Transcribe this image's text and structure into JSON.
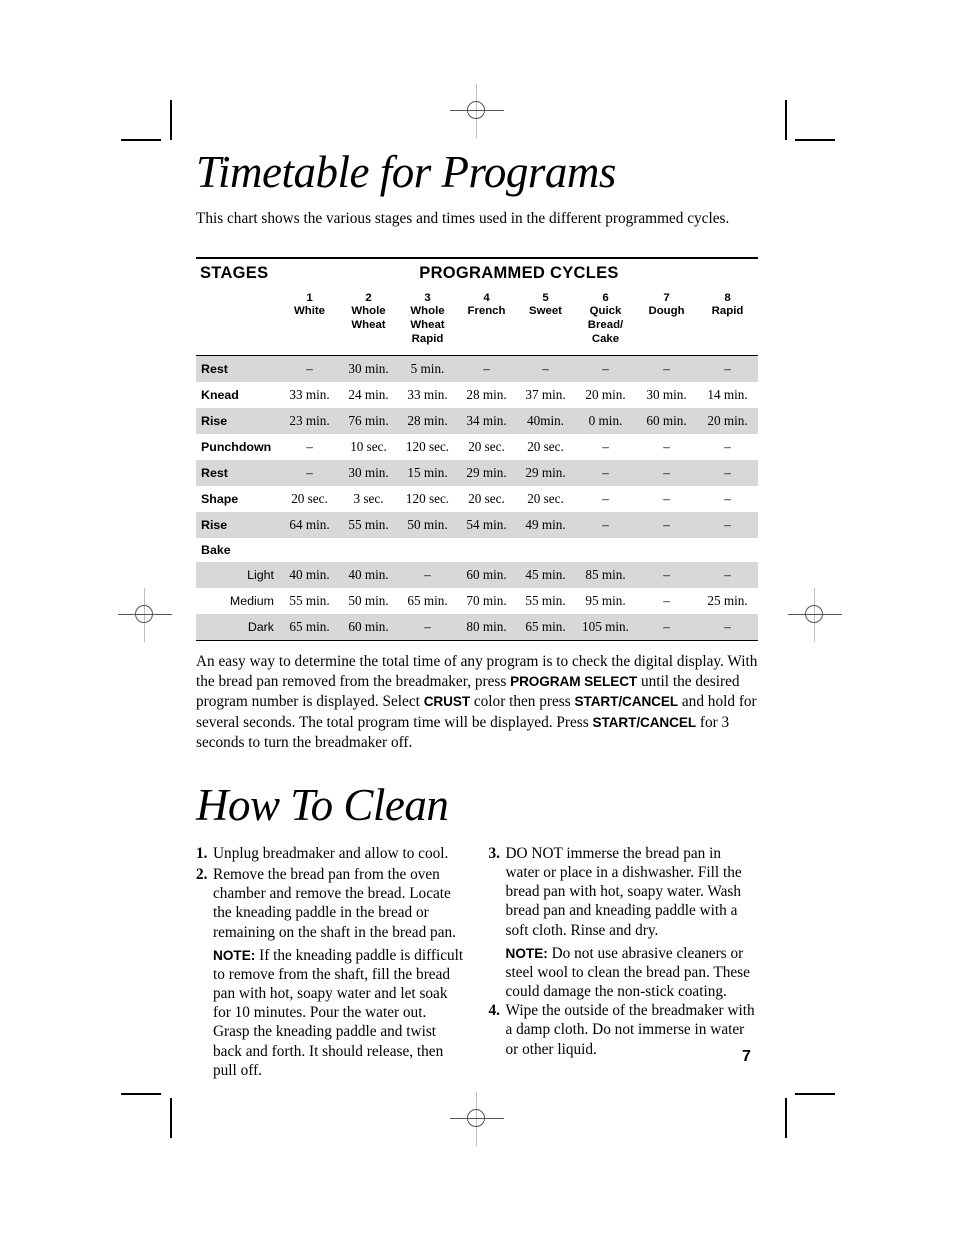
{
  "document": {
    "page_number": "7"
  },
  "section1": {
    "title": "Timetable for Programs",
    "intro": "This chart shows the various stages and times used in the different programmed cycles."
  },
  "table": {
    "stages_header": "STAGES",
    "cycles_header": "PROGRAMMED CYCLES",
    "columns": [
      {
        "num": "1",
        "name": "White"
      },
      {
        "num": "2",
        "name": "Whole\nWheat"
      },
      {
        "num": "3",
        "name": "Whole\nWheat\nRapid"
      },
      {
        "num": "4",
        "name": "French"
      },
      {
        "num": "5",
        "name": "Sweet"
      },
      {
        "num": "6",
        "name": "Quick\nBread/\nCake"
      },
      {
        "num": "7",
        "name": "Dough"
      },
      {
        "num": "8",
        "name": "Rapid"
      }
    ],
    "rows": [
      {
        "stage": "Rest",
        "shaded": true,
        "sub": false,
        "values": [
          "–",
          "30 min.",
          "5 min.",
          "–",
          "–",
          "–",
          "–",
          "–"
        ]
      },
      {
        "stage": "Knead",
        "shaded": false,
        "sub": false,
        "values": [
          "33 min.",
          "24 min.",
          "33 min.",
          "28 min.",
          "37 min.",
          "20 min.",
          "30 min.",
          "14 min."
        ]
      },
      {
        "stage": "Rise",
        "shaded": true,
        "sub": false,
        "values": [
          "23 min.",
          "76 min.",
          "28 min.",
          "34 min.",
          "40min.",
          "0 min.",
          "60 min.",
          "20 min."
        ]
      },
      {
        "stage": "Punchdown",
        "shaded": false,
        "sub": false,
        "values": [
          "–",
          "10 sec.",
          "120 sec.",
          "20 sec.",
          "20 sec.",
          "–",
          "–",
          "–"
        ]
      },
      {
        "stage": "Rest",
        "shaded": true,
        "sub": false,
        "values": [
          "–",
          "30 min.",
          "15 min.",
          "29 min.",
          "29 min.",
          "–",
          "–",
          "–"
        ]
      },
      {
        "stage": "Shape",
        "shaded": false,
        "sub": false,
        "values": [
          "20 sec.",
          "3 sec.",
          "120 sec.",
          "20 sec.",
          "20 sec.",
          "–",
          "–",
          "–"
        ]
      },
      {
        "stage": "Rise",
        "shaded": true,
        "sub": false,
        "values": [
          "64 min.",
          "55 min.",
          "50 min.",
          "54 min.",
          "49 min.",
          "–",
          "–",
          "–"
        ]
      },
      {
        "stage": "Bake",
        "shaded": false,
        "sub": false,
        "values": [
          "",
          "",
          "",
          "",
          "",
          "",
          "",
          ""
        ]
      },
      {
        "stage": "Light",
        "shaded": true,
        "sub": true,
        "values": [
          "40 min.",
          "40 min.",
          "–",
          "60 min.",
          "45 min.",
          "85 min.",
          "–",
          "–"
        ]
      },
      {
        "stage": "Medium",
        "shaded": false,
        "sub": true,
        "values": [
          "55 min.",
          "50 min.",
          "65 min.",
          "70 min.",
          "55 min.",
          "95 min.",
          "–",
          "25 min."
        ]
      },
      {
        "stage": "Dark",
        "shaded": true,
        "sub": true,
        "values": [
          "65 min.",
          "60 min.",
          "–",
          "80 min.",
          "65 min.",
          "105 min.",
          "–",
          "–"
        ]
      }
    ]
  },
  "after_table": {
    "p1": "An easy way to determine the total time of any program is to check the digital display. With the bread pan removed from the breadmaker, press ",
    "cmd1": "PROGRAM SELECT",
    "p2": " until the desired program number is displayed. Select ",
    "cmd2": "CRUST",
    "p3": " color then press ",
    "cmd3": "START/CANCEL",
    "p4": " and hold for several seconds",
    "p5": ". The total program time will be displayed. Press ",
    "cmd4": "START/CANCEL",
    "p6": " for 3 seconds to turn the breadmaker off."
  },
  "section2": {
    "title": "How To Clean",
    "left_column": [
      {
        "marker": "1.",
        "text": "Unplug breadmaker and allow to cool."
      },
      {
        "marker": "2.",
        "text": "Remove the bread pan from the oven chamber and remove the bread. Locate the kneading paddle in the bread or remaining on the shaft in the bread pan.",
        "note_label": "NOTE:",
        "note_text": " If the kneading paddle is difficult to remove from the shaft, fill the bread pan with hot, soapy water and let soak for 10 minutes. Pour the water out. Grasp the kneading paddle and twist back and forth. It should release, then pull off."
      }
    ],
    "right_column": [
      {
        "marker": "3.",
        "text": "DO NOT immerse the bread pan in water or place in a dishwasher. Fill the bread pan with hot, soapy water. Wash bread pan and kneading paddle with a soft cloth. Rinse and dry.",
        "note_label": "NOTE:",
        "note_text": " Do not use abrasive cleaners or steel wool to clean the bread pan. These could damage the non-stick coating."
      },
      {
        "marker": "4.",
        "text": "Wipe the outside of the breadmaker with a damp cloth. Do not immerse in water or other liquid."
      }
    ]
  }
}
